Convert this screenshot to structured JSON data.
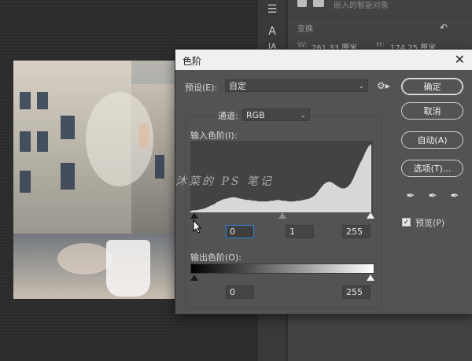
{
  "panel": {
    "embedded_label": "嵌入的智能对象",
    "transform_label": "变换",
    "w_label": "W:",
    "w_value": "261.33 厘米",
    "h_label": "H:",
    "h_value": "174.25 厘米",
    "reset_icon": "reset-icon"
  },
  "dialog": {
    "title": "色阶",
    "preset_label": "预设(E):",
    "preset_value": "自定",
    "channel_label": "通道:",
    "channel_value": "RGB",
    "input_levels_label": "输入色阶(I):",
    "output_levels_label": "输出色阶(O):",
    "input_black": "0",
    "input_gamma": "1",
    "input_white": "255",
    "output_black": "0",
    "output_white": "255",
    "buttons": {
      "ok": "确定",
      "cancel": "取消",
      "auto": "自动(A)",
      "options": "选项(T)..."
    },
    "preview_label": "预览(P)",
    "preview_checked": true,
    "watermark": "沐菜的 PS 笔记"
  },
  "histogram": {
    "profile": [
      0.02,
      0.03,
      0.03,
      0.04,
      0.05,
      0.06,
      0.08,
      0.1,
      0.12,
      0.15,
      0.17,
      0.19,
      0.2,
      0.21,
      0.22,
      0.22,
      0.21,
      0.2,
      0.19,
      0.18,
      0.18,
      0.17,
      0.17,
      0.16,
      0.16,
      0.16,
      0.16,
      0.17,
      0.17,
      0.18,
      0.18,
      0.17,
      0.17,
      0.16,
      0.16,
      0.16,
      0.17,
      0.17,
      0.18,
      0.19,
      0.2,
      0.22,
      0.25,
      0.3,
      0.36,
      0.41,
      0.44,
      0.45,
      0.43,
      0.4,
      0.37,
      0.35,
      0.35,
      0.37,
      0.42,
      0.5,
      0.6,
      0.7,
      0.78,
      0.88,
      0.96,
      1.0
    ]
  }
}
